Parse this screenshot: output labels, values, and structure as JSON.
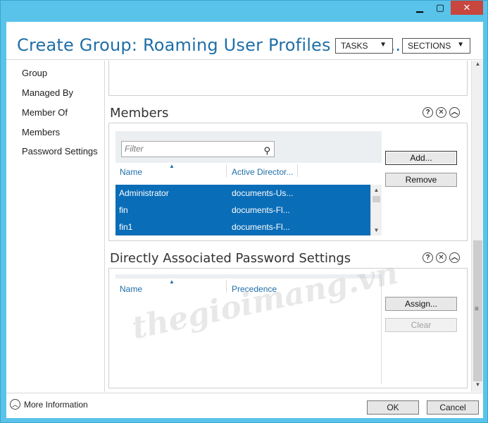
{
  "window": {
    "minimize_glyph": "▁",
    "maximize_glyph": "▢",
    "close_glyph": "✕"
  },
  "header": {
    "title": "Create Group: Roaming User Profiles Users...",
    "tasks_label": "TASKS",
    "sections_label": "SECTIONS"
  },
  "nav": {
    "items": [
      {
        "label": "Group"
      },
      {
        "label": "Managed By"
      },
      {
        "label": "Member Of"
      },
      {
        "label": "Members"
      },
      {
        "label": "Password Settings"
      }
    ]
  },
  "members": {
    "title": "Members",
    "filter_placeholder": "Filter",
    "columns": [
      "Name",
      "Active Director..."
    ],
    "rows": [
      {
        "name": "Administrator",
        "dir": "documents-Us..."
      },
      {
        "name": "fin",
        "dir": "documents-Fl..."
      },
      {
        "name": "fin1",
        "dir": "documents-Fl..."
      }
    ],
    "add_label": "Add...",
    "remove_label": "Remove"
  },
  "password_settings": {
    "title": "Directly Associated Password Settings",
    "columns": [
      "Name",
      "Precedence"
    ],
    "assign_label": "Assign...",
    "clear_label": "Clear"
  },
  "section_icons": {
    "help": "?",
    "close": "✕",
    "collapse": "︿"
  },
  "footer": {
    "more_info_label": "More Information",
    "ok_label": "OK",
    "cancel_label": "Cancel"
  },
  "watermark": "thegioimang.vn",
  "colors": {
    "title_blue": "#1f6fa8",
    "selection_blue": "#0a6db7",
    "frame_cyan": "#59c3ea",
    "close_red": "#c7463e"
  }
}
